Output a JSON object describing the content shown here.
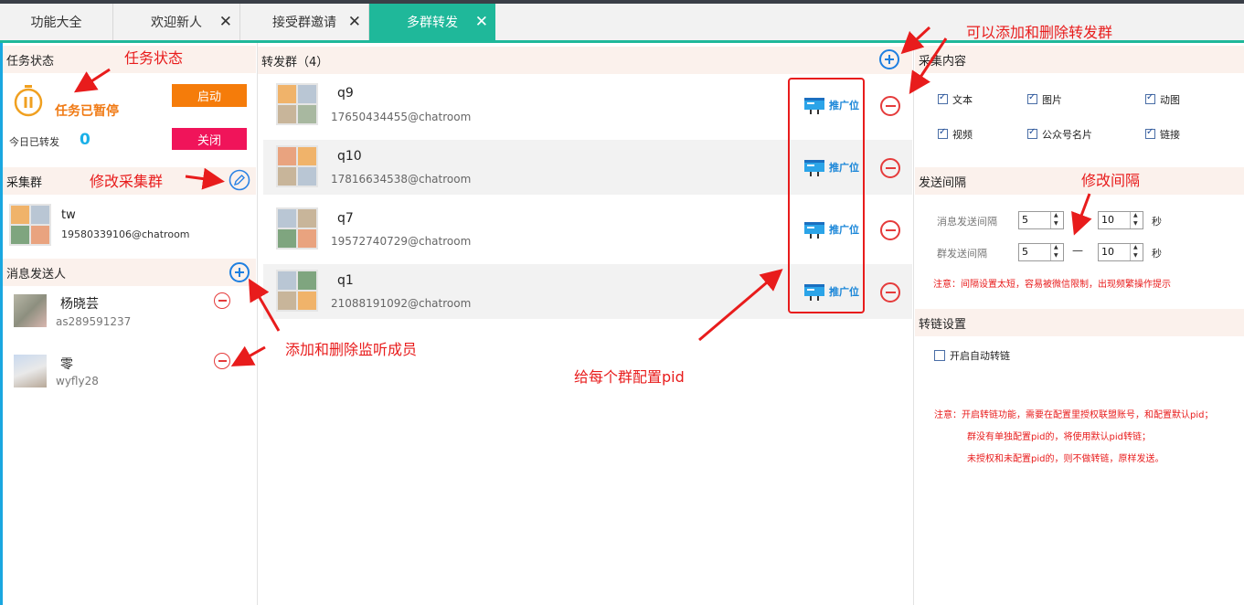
{
  "tabs": [
    {
      "label": "功能大全"
    },
    {
      "label": "欢迎新人",
      "close": "✕"
    },
    {
      "label": "接受群邀请",
      "close": "✕"
    },
    {
      "label": "多群转发",
      "close": "✕"
    }
  ],
  "left": {
    "task_status": {
      "title": "任务状态",
      "state_text": "任务已暂停",
      "start_label": "启动",
      "close_label": "关闭",
      "forwarded_label": "今日已转发",
      "forwarded_count": "0"
    },
    "collect_group": {
      "title": "采集群",
      "name": "tw",
      "id": "19580339106@chatroom"
    },
    "senders": {
      "title": "消息发送人",
      "items": [
        {
          "name": "杨晓芸",
          "id": "as289591237"
        },
        {
          "name": "零",
          "id": "wyfly28"
        }
      ]
    }
  },
  "middle": {
    "title": "转发群（4）",
    "promo_label": "推广位",
    "groups": [
      {
        "name": "q9",
        "id": "17650434455@chatroom"
      },
      {
        "name": "q10",
        "id": "17816634538@chatroom"
      },
      {
        "name": "q7",
        "id": "19572740729@chatroom"
      },
      {
        "name": "q1",
        "id": "21088191092@chatroom"
      }
    ]
  },
  "right": {
    "collect_content": {
      "title": "采集内容",
      "options": [
        {
          "label": "文本",
          "checked": true
        },
        {
          "label": "图片",
          "checked": true
        },
        {
          "label": "动图",
          "checked": true
        },
        {
          "label": "视频",
          "checked": true
        },
        {
          "label": "公众号名片",
          "checked": true
        },
        {
          "label": "链接",
          "checked": true
        }
      ]
    },
    "interval": {
      "title": "发送间隔",
      "msg_label": "消息发送间隔",
      "msg_min": "5",
      "msg_max": "10",
      "group_label": "群发送间隔",
      "group_min": "5",
      "group_max": "10",
      "dash": "—",
      "unit": "秒",
      "warning": "注意：间隔设置太短，容易被微信限制，出现频繁操作提示"
    },
    "link": {
      "title": "转链设置",
      "auto_label": "开启自动转链",
      "note1": "注意：开启转链功能，需要在配置里授权联盟账号，和配置默认pid；",
      "note2": "群没有单独配置pid的，将使用默认pid转链；",
      "note3": "未授权和未配置pid的，则不做转链，原样发送。"
    }
  },
  "annotations": {
    "task_status": "任务状态",
    "modify_collect": "修改采集群",
    "add_remove_members": "添加和删除监听成员",
    "configure_pid": "给每个群配置pid",
    "add_remove_groups": "可以添加和删除转发群",
    "modify_interval": "修改间隔"
  },
  "colors": {
    "accent": "#1fb89a",
    "start_button": "#f57c0a",
    "close_button": "#f0145a",
    "annotation": "#e81c1c",
    "link_blue": "#1a86d8"
  }
}
